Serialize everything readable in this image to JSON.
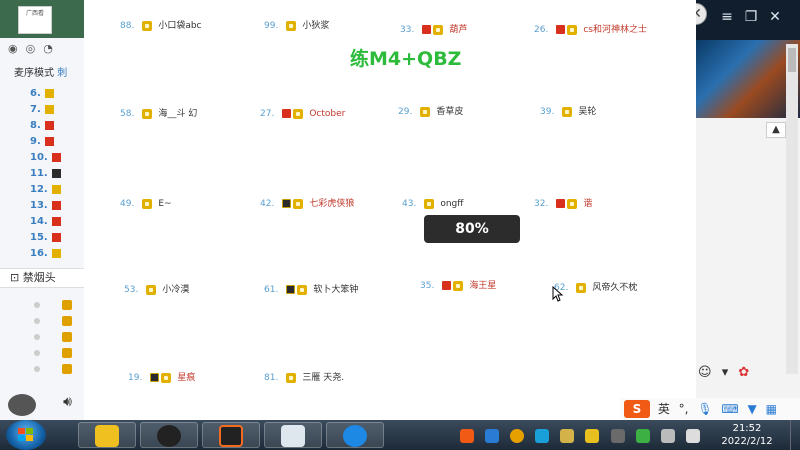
{
  "main_window": {
    "title": "练M4+QBZ",
    "progress_overlay": "80%",
    "players": [
      {
        "num": "88.",
        "name": "小口袋abc",
        "badge": "crown",
        "name_red": false
      },
      {
        "num": "99.",
        "name": "小狄浆",
        "badge": "crown",
        "name_red": false
      },
      {
        "num": "33.",
        "name": "葫芦",
        "badge": "vip-crown",
        "name_red": true
      },
      {
        "num": "26.",
        "name": "cs和河神林之士",
        "badge": "vip-crown",
        "name_red": true
      },
      {
        "num": "58.",
        "name": "海__斗 幻",
        "badge": "crown",
        "name_red": false
      },
      {
        "num": "27.",
        "name": "October",
        "badge": "vip-crown",
        "name_red": true
      },
      {
        "num": "29.",
        "name": "香草皮",
        "badge": "crown",
        "name_red": false
      },
      {
        "num": "39.",
        "name": "吴轮",
        "badge": "crown",
        "name_red": false
      },
      {
        "num": "49.",
        "name": "E~",
        "badge": "crown",
        "name_red": false
      },
      {
        "num": "42.",
        "name": "七彩虎侠狼",
        "badge": "lvl-crown",
        "name_red": true
      },
      {
        "num": "43.",
        "name": "ongff",
        "badge": "crown",
        "name_red": false
      },
      {
        "num": "32.",
        "name": "谐",
        "badge": "vip-crown",
        "name_red": true
      },
      {
        "num": "53.",
        "name": "小冷漠",
        "badge": "crown",
        "name_red": false
      },
      {
        "num": "61.",
        "name": "软卜大笨钟",
        "badge": "lvl-crown",
        "name_red": false
      },
      {
        "num": "35.",
        "name": "海王星",
        "badge": "vip-crown",
        "name_red": true
      },
      {
        "num": "62.",
        "name": "风帝久不枕",
        "badge": "crown",
        "name_red": false
      },
      {
        "num": "19.",
        "name": "星痕",
        "badge": "lvl-crown",
        "name_red": true
      },
      {
        "num": "81.",
        "name": "三雁 天尧.",
        "badge": "crown",
        "name_red": false
      }
    ]
  },
  "left_app": {
    "logo_text": "广西看",
    "mode_label": "麦序模式",
    "mode_suffix": "刺",
    "list_numbers": [
      "6.",
      "7.",
      "8.",
      "9.",
      "10.",
      "11.",
      "12.",
      "13.",
      "14.",
      "15.",
      "16."
    ],
    "ban_header": "禁烟头"
  },
  "ime": {
    "logo": "S",
    "lang": "英"
  },
  "taskbar": {
    "time": "21:52",
    "date": "2022/2/12"
  },
  "colors": {
    "title_green": "#2dbb3c",
    "number_blue": "#5aa0d0",
    "vip_red": "#d8301c",
    "crown_gold": "#e2b100"
  }
}
